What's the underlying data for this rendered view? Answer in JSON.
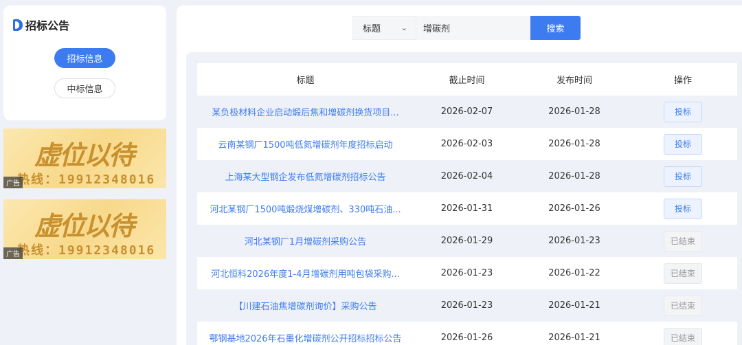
{
  "sidebar": {
    "title": "招标公告",
    "nav": [
      {
        "label": "招标信息",
        "active": true
      },
      {
        "label": "中标信息",
        "active": false
      }
    ]
  },
  "ads": [
    {
      "headline": "虚位以待",
      "phone": "热线：19912348016",
      "tag": "广告"
    },
    {
      "headline": "虚位以待",
      "phone": "热线：19912348016",
      "tag": "广告"
    }
  ],
  "search": {
    "select_value": "标题",
    "input_value": "增碳剂",
    "button_label": "搜索"
  },
  "table": {
    "headers": [
      "标题",
      "截止时间",
      "发布时间",
      "操作"
    ],
    "rows": [
      {
        "title": "某负极材料企业启动煅后焦和增碳剂换货项目...",
        "deadline": "2026-02-07",
        "published": "2026-01-28",
        "action": "投标",
        "status": "open"
      },
      {
        "title": "云南某钢厂1500吨低氮增碳剂年度招标启动",
        "deadline": "2026-02-03",
        "published": "2026-01-28",
        "action": "投标",
        "status": "open"
      },
      {
        "title": "上海某大型钢企发布低氮增碳剂招标公告",
        "deadline": "2026-02-04",
        "published": "2026-01-28",
        "action": "投标",
        "status": "open"
      },
      {
        "title": "河北某钢厂1500吨煅烧煤增碳剂、330吨石油...",
        "deadline": "2026-01-31",
        "published": "2026-01-26",
        "action": "投标",
        "status": "open"
      },
      {
        "title": "河北某钢厂1月增碳剂采购公告",
        "deadline": "2026-01-29",
        "published": "2026-01-23",
        "action": "已结束",
        "status": "ended"
      },
      {
        "title": "河北恒科2026年度1-4月增碳剂用吨包袋采购...",
        "deadline": "2026-01-23",
        "published": "2026-01-22",
        "action": "已结束",
        "status": "ended"
      },
      {
        "title": "【川建石油焦增碳剂询价】采购公告",
        "deadline": "2026-01-23",
        "published": "2026-01-21",
        "action": "已结束",
        "status": "ended"
      },
      {
        "title": "鄂钢基地2026年石墨化增碳剂公开招标招标公告",
        "deadline": "2026-01-26",
        "published": "2026-01-21",
        "action": "已结束",
        "status": "ended"
      }
    ]
  },
  "colors": {
    "accent": "#3d7cf0",
    "page_bg": "#eef2f8",
    "ad_gold": "#c8902e"
  }
}
